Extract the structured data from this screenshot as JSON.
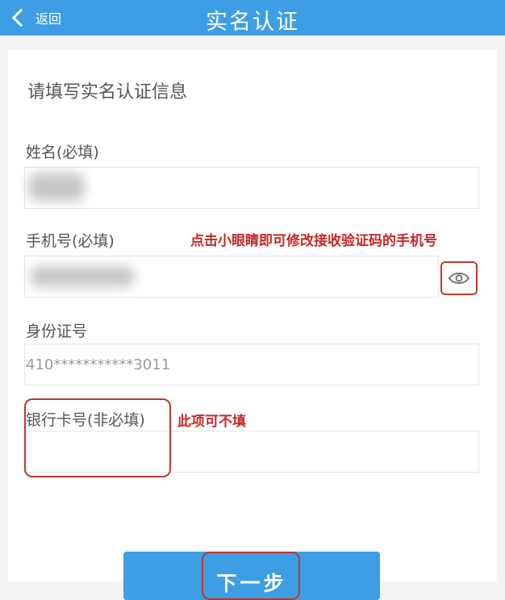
{
  "header": {
    "back_label": "返回",
    "title": "实名认证"
  },
  "form": {
    "intro": "请填写实名认证信息",
    "name_label": "姓名(必填)",
    "phone_label": "手机号(必填)",
    "id_label": "身份证号",
    "id_value": "410***********3011",
    "bank_label": "银行卡号(非必填)",
    "next_label": "下一步"
  },
  "annotations": {
    "eye_hint": "点击小眼睛即可修改接收验证码的手机号",
    "bank_hint": "此项可不填"
  },
  "colors": {
    "accent": "#3d9ee4",
    "annotation_red": "#c62828"
  }
}
